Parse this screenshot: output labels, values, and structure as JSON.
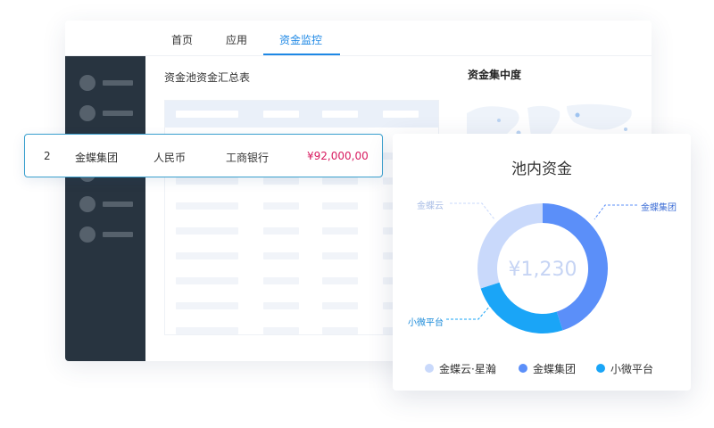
{
  "tabs": [
    {
      "label": "首页",
      "active": false
    },
    {
      "label": "应用",
      "active": false
    },
    {
      "label": "资金监控",
      "active": true
    }
  ],
  "table_title": "资金池资金汇总表",
  "concentration_title": "资金集中度",
  "selected_row": {
    "index": "2",
    "company": "金蝶集团",
    "currency": "人民币",
    "bank": "工商银行",
    "amount": "¥92,000,00"
  },
  "pool_card": {
    "title": "池内资金",
    "center_value": "¥1,230",
    "callouts": {
      "cloud": "金蝶云",
      "group": "金蝶集团",
      "micro": "小微平台"
    },
    "legend": [
      {
        "label": "金蝶云·星瀚",
        "color": "#c9d9fb"
      },
      {
        "label": "金蝶集团",
        "color": "#5b8ff9"
      },
      {
        "label": "小微平台",
        "color": "#1aa5f7"
      }
    ]
  },
  "chart_data": {
    "type": "pie",
    "categories": [
      "金蝶云·星瀚",
      "金蝶集团",
      "小微平台"
    ],
    "values": [
      30,
      45,
      25
    ],
    "colors": [
      "#c9d9fb",
      "#5b8ff9",
      "#1aa5f7"
    ]
  },
  "colors": {
    "accent": "#1e88e5",
    "sidebar": "#283440",
    "amount": "#d81b60",
    "selected_border": "#3aa0ce"
  }
}
